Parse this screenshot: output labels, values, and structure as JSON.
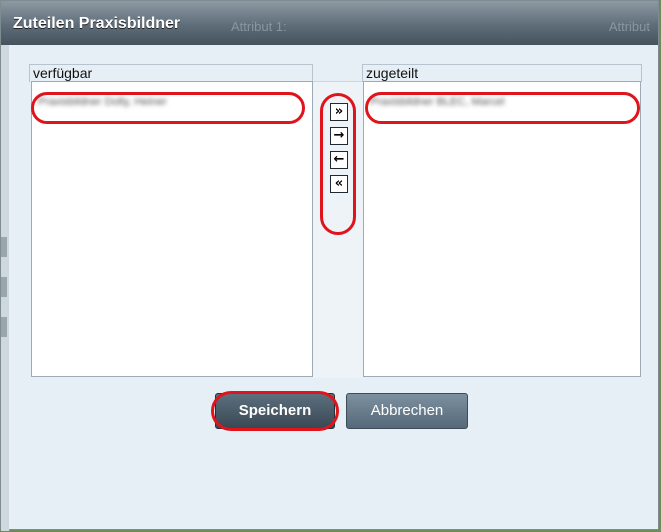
{
  "dialog": {
    "title": "Zuteilen Praxisbildner",
    "ghost_left": "Attribut 1:",
    "ghost_right": "Attribut"
  },
  "available": {
    "label": "verfügbar",
    "items": [
      "Praxisbildner Dolly, Heiner"
    ]
  },
  "assigned": {
    "label": "zugeteilt",
    "items": [
      "Praxisbildner BLEC, Marcel"
    ]
  },
  "transfer": {
    "move_all_right": "»",
    "move_right": "→",
    "move_left": "←",
    "move_all_left": "«"
  },
  "buttons": {
    "save": "Speichern",
    "cancel": "Abbrechen"
  },
  "colors": {
    "highlight": "#e0141b",
    "titlebar": "#5e6d79",
    "background": "#6d8a5a"
  }
}
